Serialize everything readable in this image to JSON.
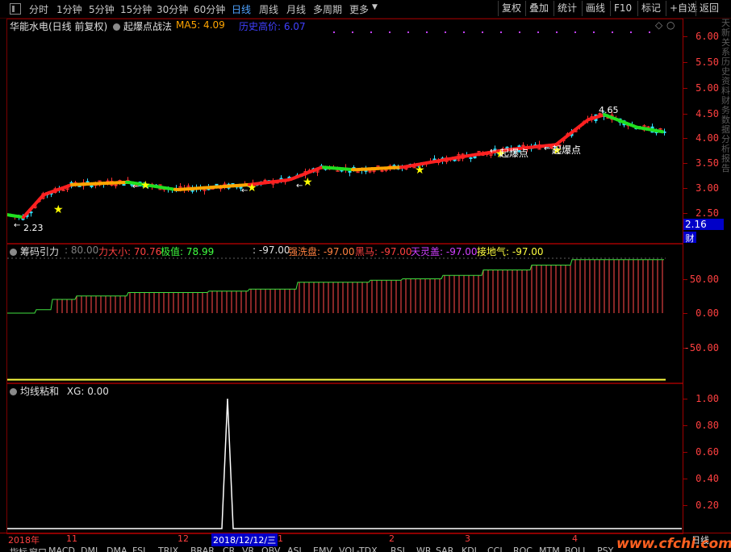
{
  "toolbar": {
    "periods": [
      "分时",
      "1分钟",
      "5分钟",
      "15分钟",
      "30分钟",
      "60分钟",
      "日线",
      "周线",
      "月线",
      "多周期",
      "更多"
    ],
    "active_period": "日线",
    "buttons": [
      "复权",
      "叠加",
      "统计",
      "画线",
      "F10",
      "标记",
      "+自选",
      "返回"
    ]
  },
  "main_chart": {
    "stock_name": "华能水电(日线 前复权)",
    "indicator_name": "起爆点战法",
    "ma5_label": "MA5: 4.09",
    "history_high_label": "历史高价: 6.07",
    "price_axis": [
      "6.00",
      "5.50",
      "5.00",
      "4.50",
      "4.00",
      "3.50",
      "3.00",
      "2.50"
    ],
    "high_annotation": "4.65",
    "low_annotation": "2.23",
    "signal_label_1": "起爆点",
    "signal_label_2": "起爆点",
    "current_price": "2.16",
    "finance_badge": "财",
    "colors": {
      "ma_up": "#ff2020",
      "ma_mid": "#ffa500",
      "ma_down": "#20e020",
      "star": "#ffff00"
    }
  },
  "chip_panel": {
    "title": "筹码引力",
    "value_0": ": 80.00",
    "force_label": "力大小: 70.76",
    "extreme_label": "极值: 78.99",
    "colon_label": ": -97.00",
    "wash_label": "强洗盘: -97.00",
    "horse_label": "黑马: -97.00",
    "cover_label": "天灵盖: -97.00",
    "ground_label": "接地气: -97.00",
    "axis": [
      "50.00",
      "0.00",
      "-50.00"
    ]
  },
  "ma_panel": {
    "title": "均线粘和",
    "xg_label": "XG: 0.00",
    "axis": [
      "1.00",
      "0.80",
      "0.60",
      "0.40",
      "0.20"
    ]
  },
  "date_axis": {
    "labels": [
      "2018年",
      "11",
      "12",
      "2018/12/12/三",
      "1",
      "2",
      "3",
      "4"
    ],
    "right_label": "日线"
  },
  "bottom_tabs": [
    "指标",
    "窗口",
    "MACD",
    "DMI",
    "DMA",
    "FSL",
    "TRIX",
    "BRAR",
    "CR",
    "VR",
    "OBV",
    "ASI",
    "EMV",
    "VOL-TDX",
    "RSI",
    "WR",
    "SAR",
    "KDJ",
    "CCI",
    "ROC",
    "MTM",
    "BOLL",
    "PSY"
  ],
  "watermark": "www.cfchi.com",
  "side_text": "天新关系历史资料财务数据分析报告"
}
